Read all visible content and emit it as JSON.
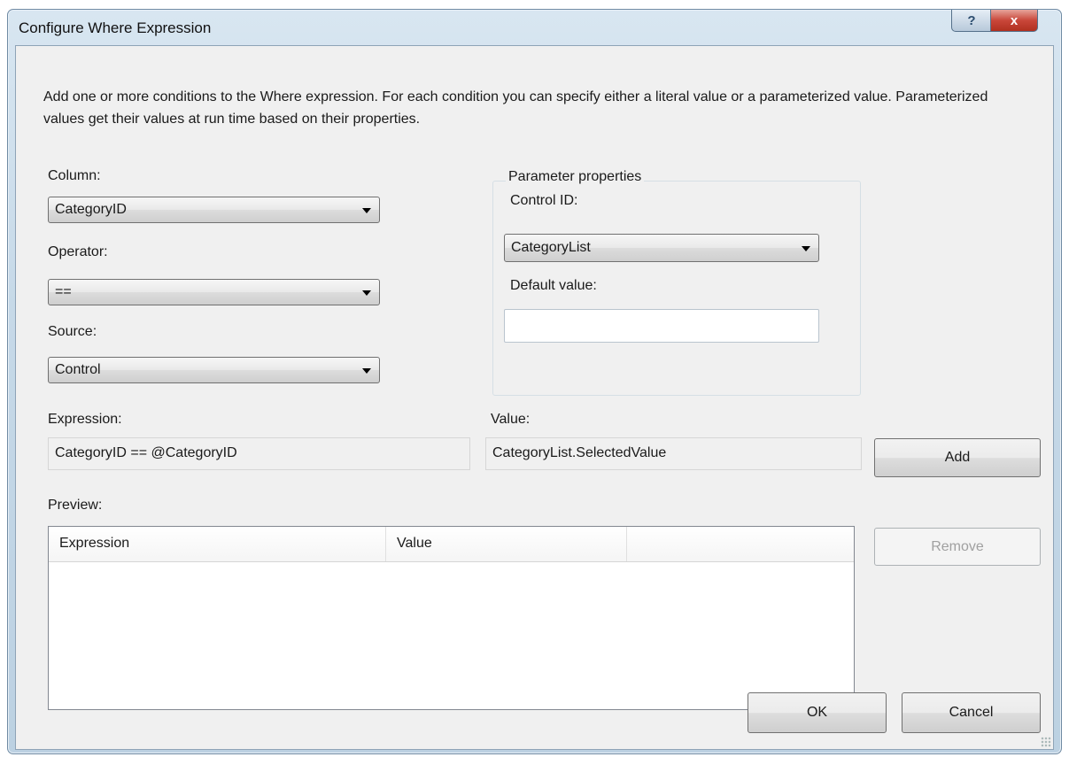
{
  "window": {
    "title": "Configure Where Expression",
    "help_glyph": "?",
    "close_glyph": "x"
  },
  "description": "Add one or more conditions to the Where expression. For each condition you can specify either a literal value or a parameterized value. Parameterized values get their values at run time based on their properties.",
  "left": {
    "column_label": "Column:",
    "column_value": "CategoryID",
    "operator_label": "Operator:",
    "operator_value": "==",
    "source_label": "Source:",
    "source_value": "Control"
  },
  "parameter_properties": {
    "legend": "Parameter properties",
    "control_id_label": "Control ID:",
    "control_id_value": "CategoryList",
    "default_value_label": "Default value:",
    "default_value": ""
  },
  "expression": {
    "label": "Expression:",
    "value": "CategoryID == @CategoryID"
  },
  "value": {
    "label": "Value:",
    "value": "CategoryList.SelectedValue"
  },
  "buttons": {
    "add": "Add",
    "remove": "Remove",
    "ok": "OK",
    "cancel": "Cancel"
  },
  "preview": {
    "label": "Preview:",
    "columns": [
      "Expression",
      "Value",
      ""
    ],
    "rows": []
  }
}
